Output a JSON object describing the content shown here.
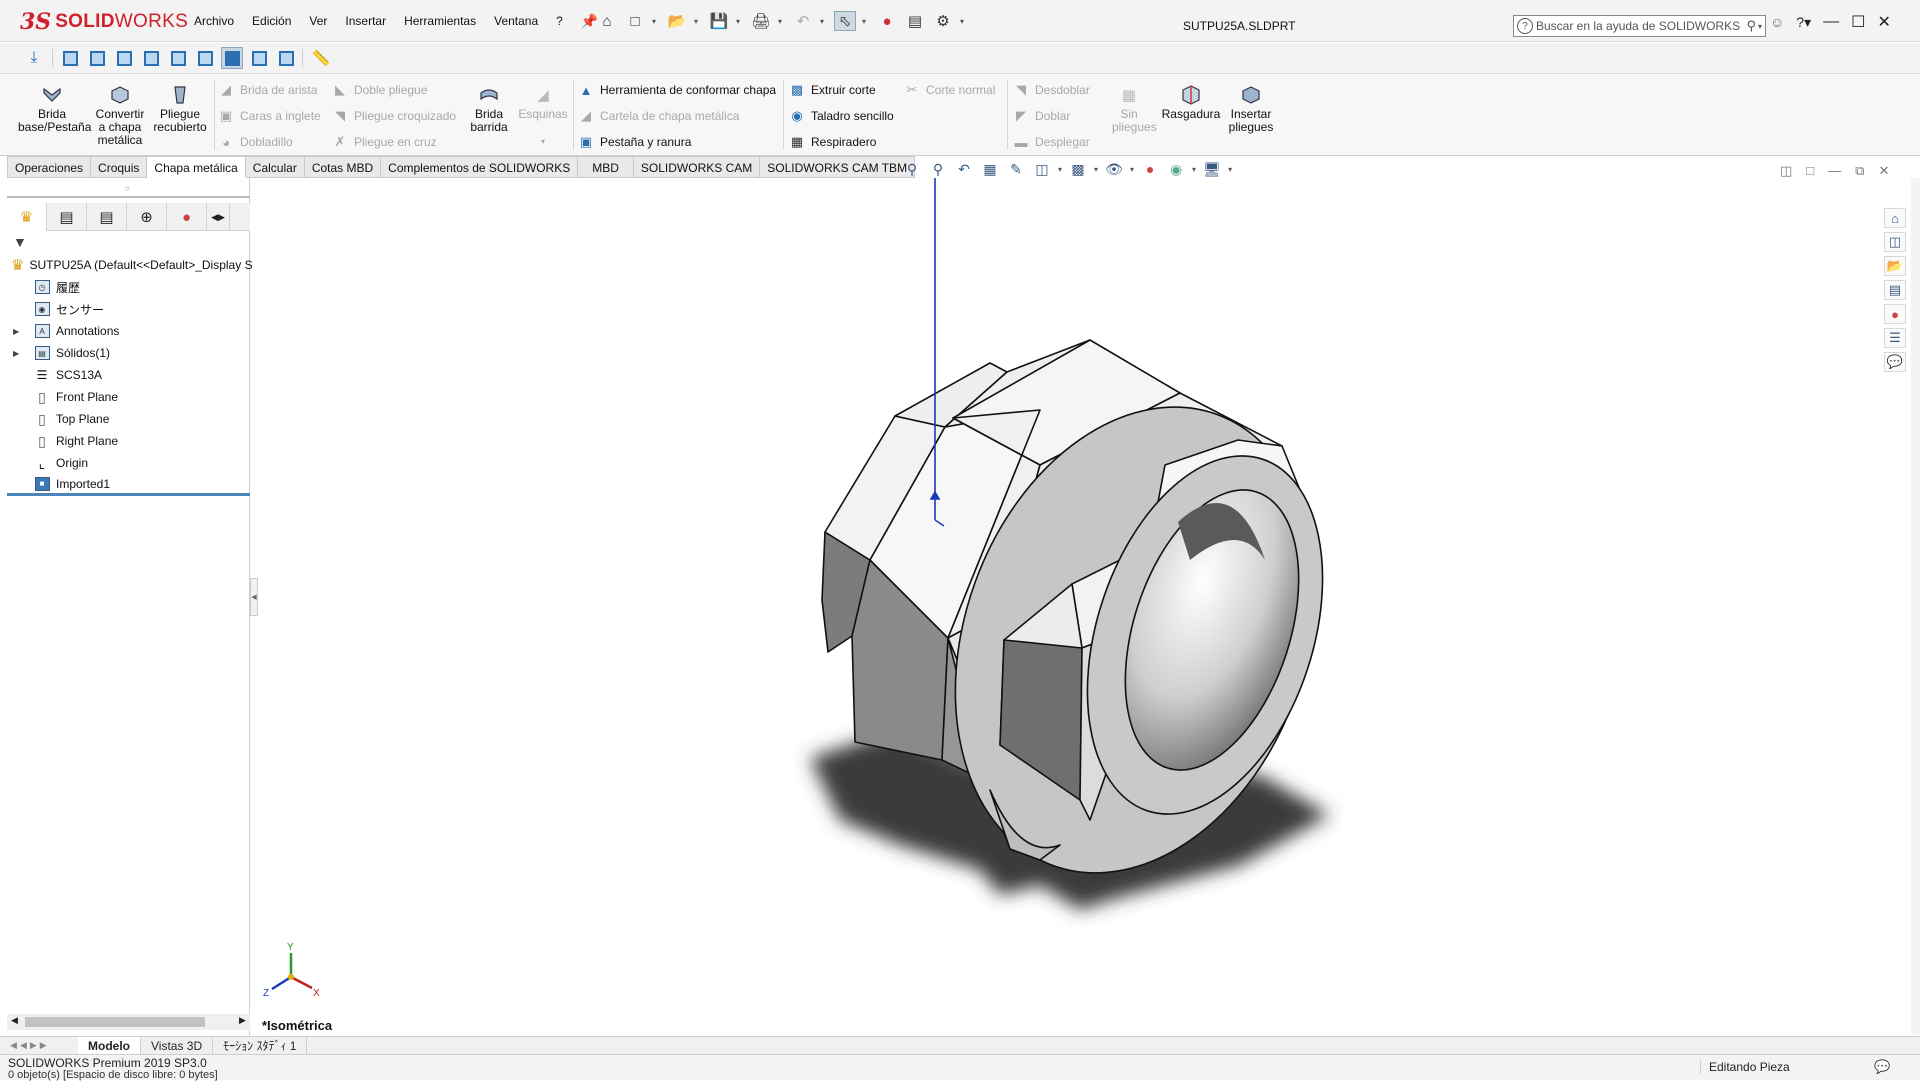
{
  "app": {
    "logo_ds": "3S",
    "logo_text_bold": "SOLID",
    "logo_text_light": "WORKS",
    "document_title": "SUTPU25A.SLDPRT",
    "search_placeholder": "Buscar en la ayuda de SOLIDWORKS"
  },
  "menu": [
    "Archivo",
    "Edición",
    "Ver",
    "Insertar",
    "Herramientas",
    "Ventana",
    "?"
  ],
  "command_manager": {
    "brida_base": "Brida base/Pestaña",
    "convertir": "Convertir a chapa metálica",
    "pliegue_recubierto": "Pliegue recubierto",
    "brida_arista": "Brida de arista",
    "caras_inglete": "Caras a inglete",
    "dobladillo": "Dobladillo",
    "doble_pliegue": "Doble pliegue",
    "pliegue_croquizado": "Pliegue croquizado",
    "pliegue_cruz": "Pliegue en cruz",
    "brida_barrida": "Brida barrida",
    "esquinas": "Esquinas",
    "herramienta_conformar": "Herramienta de conformar chapa",
    "cartela": "Cartela de chapa metálica",
    "pestana_ranura": "Pestaña y ranura",
    "extruir_corte": "Extruir corte",
    "taladro_sencillo": "Taladro sencillo",
    "respiradero": "Respiradero",
    "corte_normal": "Corte normal",
    "desdoblar": "Desdoblar",
    "doblar": "Doblar",
    "desplegar": "Desplegar",
    "sin_pliegues": "Sin pliegues",
    "rasgadura": "Rasgadura",
    "insertar_pliegues": "Insertar pliegues"
  },
  "tabs": [
    "Operaciones",
    "Croquis",
    "Chapa metálica",
    "Calcular",
    "Cotas MBD",
    "Complementos de SOLIDWORKS",
    "MBD",
    "SOLIDWORKS CAM",
    "SOLIDWORKS CAM TBM"
  ],
  "active_tab": "Chapa metálica",
  "feature_tree": {
    "root": "SUTPU25A  (Default<<Default>_Display S",
    "items": [
      {
        "label": "履歴",
        "icon": "history-icon",
        "expandable": false
      },
      {
        "label": "センサー",
        "icon": "sensor-icon",
        "expandable": false
      },
      {
        "label": "Annotations",
        "icon": "annotations-icon",
        "expandable": true
      },
      {
        "label": "Sólidos(1)",
        "icon": "solid-bodies-icon",
        "expandable": true
      },
      {
        "label": "SCS13A",
        "icon": "material-icon",
        "expandable": false
      },
      {
        "label": "Front Plane",
        "icon": "plane-icon",
        "expandable": false
      },
      {
        "label": "Top Plane",
        "icon": "plane-icon",
        "expandable": false
      },
      {
        "label": "Right Plane",
        "icon": "plane-icon",
        "expandable": false
      },
      {
        "label": "Origin",
        "icon": "origin-icon",
        "expandable": false
      },
      {
        "label": "Imported1",
        "icon": "imported-body-icon",
        "expandable": false
      }
    ]
  },
  "viewport": {
    "view_name": "*Isométrica",
    "triad_x": "X",
    "triad_y": "Y",
    "triad_z": "Z"
  },
  "bottom_tabs": [
    "Modelo",
    "Vistas 3D",
    "ﾓｰｼｮﾝ ｽﾀﾃﾞｨ 1"
  ],
  "active_bottom_tab": "Modelo",
  "status": {
    "version": "SOLIDWORKS Premium 2019 SP3.0",
    "message": "0 objeto(s) [Espacio de disco libre: 0 bytes]",
    "mode": "Editando Pieza"
  },
  "colors": {
    "brand_red": "#d0202a",
    "accent_blue": "#2a6fb0",
    "tree_selection": "#4a86b8"
  }
}
